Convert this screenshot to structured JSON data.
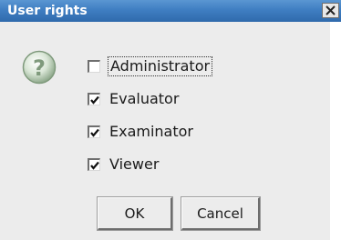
{
  "dialog": {
    "title": "User rights",
    "close_label": "close"
  },
  "question_icon": "question-icon",
  "options": [
    {
      "label": "Administrator",
      "checked": false,
      "focused": true
    },
    {
      "label": "Evaluator",
      "checked": true,
      "focused": false
    },
    {
      "label": "Examinator",
      "checked": true,
      "focused": false
    },
    {
      "label": "Viewer",
      "checked": true,
      "focused": false
    }
  ],
  "buttons": {
    "ok_label": "OK",
    "cancel_label": "Cancel"
  },
  "colors": {
    "titlebar": "#3f7ec2",
    "dialog_bg": "#ececec",
    "title_text": "#ffffff"
  }
}
